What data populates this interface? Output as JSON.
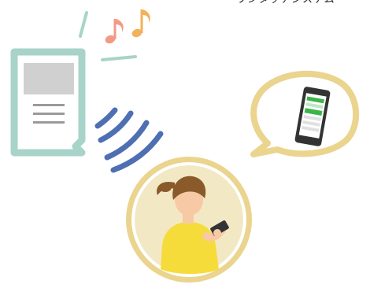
{
  "caption": {
    "text": "ワンタッチシステム"
  },
  "colors": {
    "device_frame": "#a8d3c8",
    "device_screen": "#d0d0d0",
    "signal_waves": "#4f6fb3",
    "music_notes": [
      "#f39a86",
      "#f3b25a"
    ],
    "badge_gold": "#ead48e",
    "badge_cream": "#f3e8c4",
    "bubble_border": "#ead48e",
    "person_shirt": "#f5dc3a",
    "person_hair": "#8a5a2a",
    "phone_body": "#333333",
    "phone_screen_accent": "#3bb54a"
  },
  "icons": {
    "device": "nfc-reader-device-icon",
    "signal": "wireless-signal-icon",
    "notes": "music-note-icon",
    "person": "woman-with-smartphone-icon",
    "bubble_phone": "smartphone-icon"
  }
}
